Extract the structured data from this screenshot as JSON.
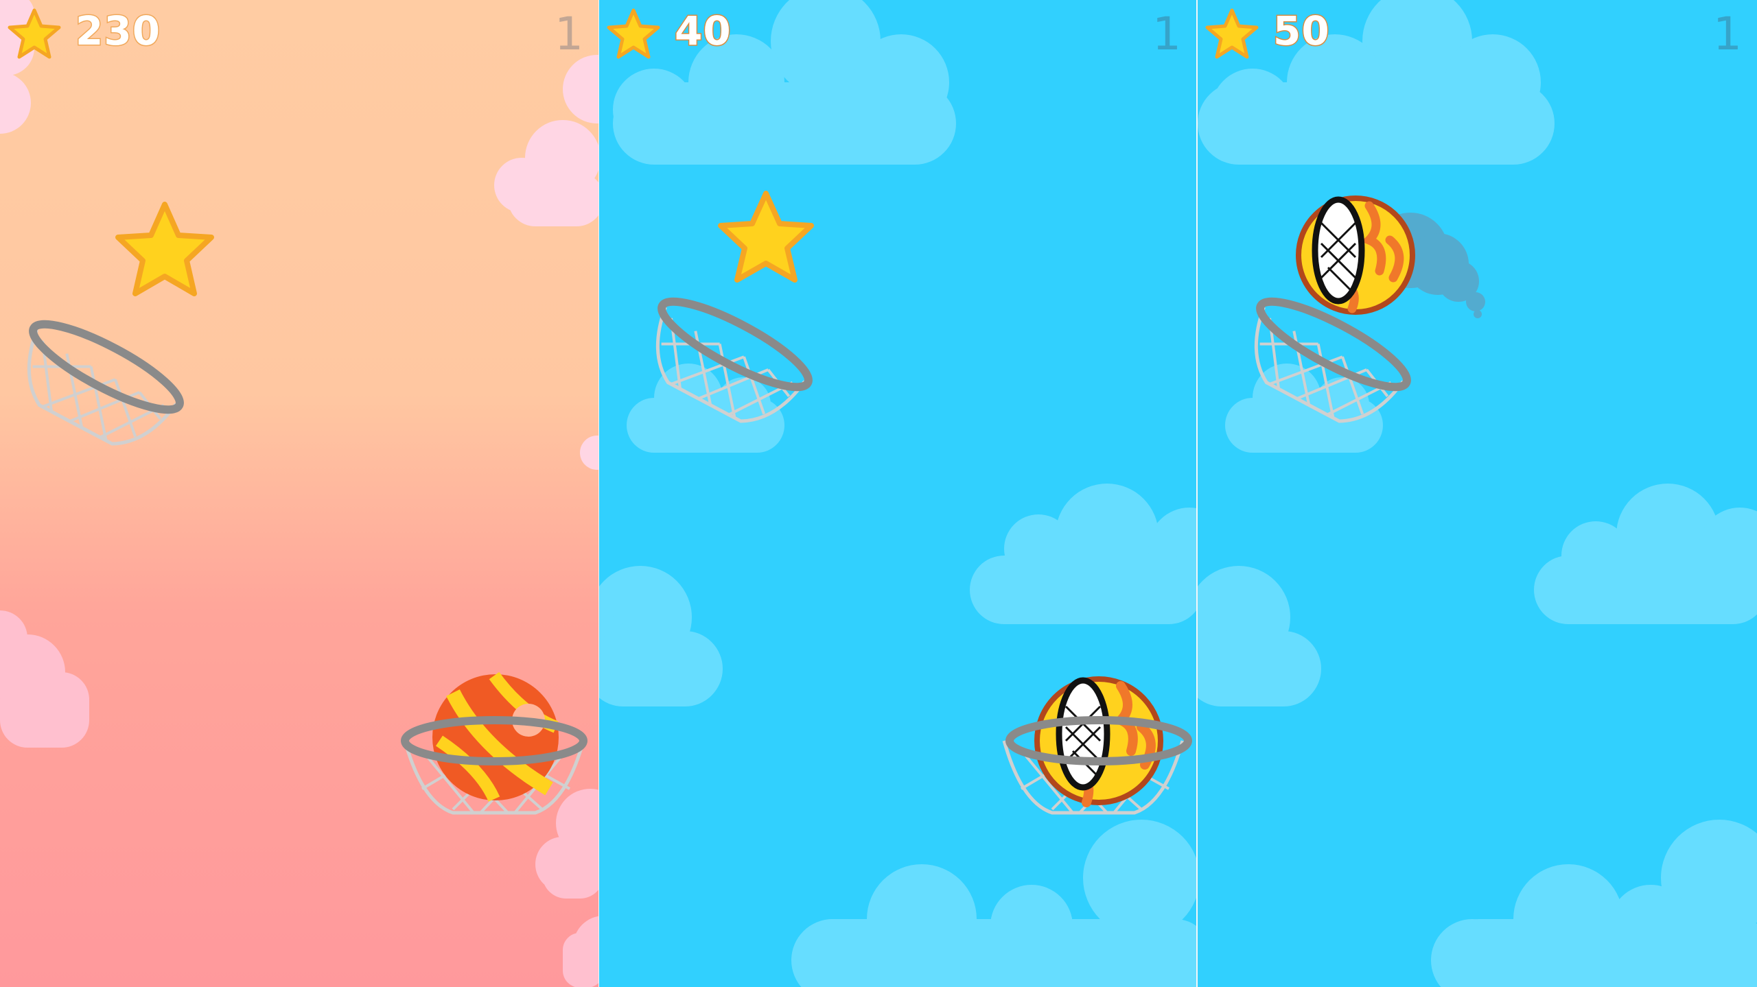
{
  "colors": {
    "sunset_top": "#ffcca3",
    "sunset_bottom": "#ff999c",
    "sky_blue": "#31d0fe",
    "cloud_blue": "#66ddff",
    "cloud_pink": "#ffd6e4",
    "star_yellow": "#ffd21e",
    "star_outline": "#f5a623",
    "hoop_grey": "#8a8a8a",
    "net_grey": "#d9d9d9"
  },
  "panels": [
    {
      "theme": "sunset",
      "score": "230",
      "level": "1",
      "ball_skin": "orange-beach-ball",
      "collectible": "star",
      "hud_icon": "star-icon"
    },
    {
      "theme": "sky",
      "score": "40",
      "level": "1",
      "ball_skin": "fire-net-ball",
      "collectible": "star",
      "hud_icon": "star-icon"
    },
    {
      "theme": "sky",
      "score": "50",
      "level": "1",
      "ball_skin": "fire-net-ball",
      "collectible": "none",
      "hud_icon": "star-icon"
    }
  ]
}
